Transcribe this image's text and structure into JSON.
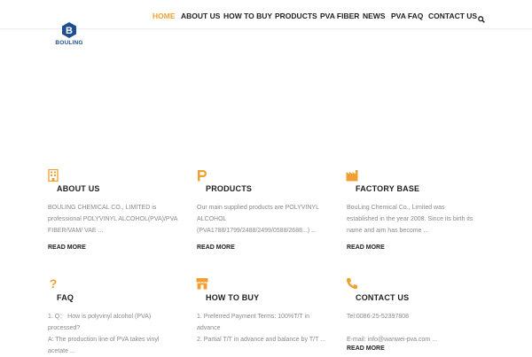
{
  "brand": {
    "name": "BOULING",
    "color": "#1d4f91",
    "accent": "#f0a030"
  },
  "nav": {
    "items": [
      "HOME",
      "ABOUT US",
      "HOW TO BUY",
      "PRODUCTS",
      "PVA FIBER",
      "NEWS",
      "PVA FAQ",
      "CONTACT US"
    ],
    "active": "HOME",
    "search_icon": "search-icon"
  },
  "boxes": [
    {
      "icon": "building-icon",
      "title": "ABOUT US",
      "lines": [
        "BOULING CHEMICAL CO., LIMITED is",
        "professional POLYVINYL ALCOHOL(PVA)/PVA",
        "FIBER/VAM/ VAE ..."
      ],
      "more": "READ MORE"
    },
    {
      "icon": "p-letter-icon",
      "title": "PRODUCTS",
      "lines": [
        "Our main supplied products are POLYVINYL",
        "ALCOHOL",
        "(PVA1788/1799/2488/2499/0588/2688...) ..."
      ],
      "more": "READ MORE"
    },
    {
      "icon": "factory-icon",
      "title": "FACTORY BASE",
      "lines": [
        "BouLing Chemical Co., Limited was",
        "established in the year 2008. Since its birth its",
        "name and aim has become ..."
      ],
      "more": "READ MORE"
    },
    {
      "icon": "question-icon",
      "title": "FAQ",
      "lines": [
        "1. Q： How is polyvinyl alcohol (PVA)",
        "processed?",
        "A: The production line of PVA takes vinyl",
        "acetate ..."
      ],
      "more": ""
    },
    {
      "icon": "store-icon",
      "title": "HOW TO BUY",
      "lines": [
        "1. Preferred Payment Terms: 100%T/T in",
        "advance",
        "2. Partial T/T in advance and balance by T/T ..."
      ],
      "more": ""
    },
    {
      "icon": "phone-icon",
      "title": "CONTACT US",
      "lines": [
        "Tel:0086-25-52397808",
        "",
        "E-mail: info@wanwei-pva.com ..."
      ],
      "more": "READ MORE"
    }
  ]
}
